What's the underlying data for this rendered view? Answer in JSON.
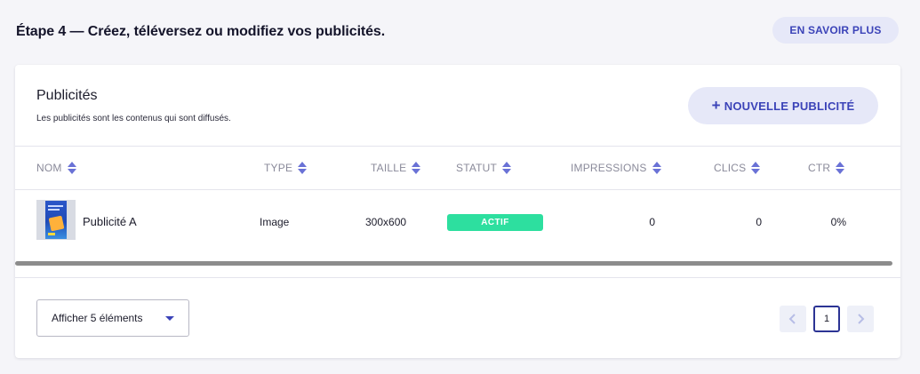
{
  "header": {
    "step_title": "Étape 4 — Créez, téléversez ou modifiez vos publicités.",
    "learn_more": "EN SAVOIR PLUS"
  },
  "card": {
    "title": "Publicités",
    "subtitle": "Les publicités sont les contenus qui sont diffusés.",
    "new_button": "NOUVELLE PUBLICITÉ"
  },
  "table": {
    "columns": [
      "NOM",
      "TYPE",
      "TAILLE",
      "STATUT",
      "IMPRESSIONS",
      "CLICS",
      "CTR"
    ],
    "rows": [
      {
        "name": "Publicité A",
        "type": "Image",
        "size": "300x600",
        "status": "ACTIF",
        "impressions": "0",
        "clicks": "0",
        "ctr": "0%"
      }
    ]
  },
  "footer": {
    "page_size_label": "Afficher 5 éléments",
    "current_page": "1"
  },
  "icons": {
    "sort": "sort-icon",
    "plus": "plus-icon",
    "caret": "caret-down-icon",
    "prev": "chevron-left-icon",
    "next": "chevron-right-icon"
  },
  "colors": {
    "accent": "#3b43b8",
    "accent_bg": "#e6e8f8",
    "status_active": "#2ddf9f",
    "background": "#f5f5f9"
  }
}
